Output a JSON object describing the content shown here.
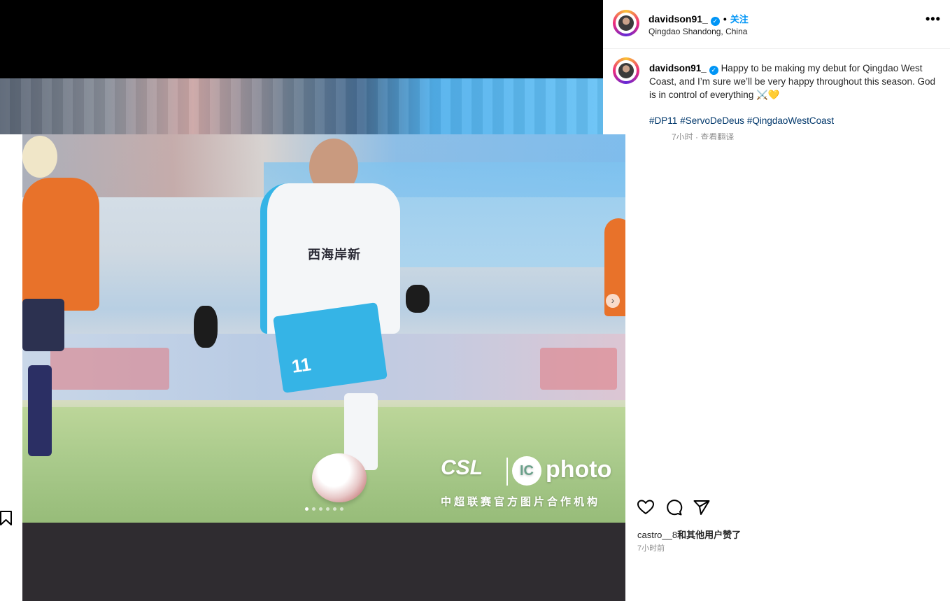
{
  "post": {
    "username": "davidson91_",
    "follow_label": "关注",
    "location": "Qingdao Shandong, China",
    "more_label": "•••"
  },
  "caption": {
    "username": "davidson91_",
    "text": "Happy to be making my debut for Qingdao West Coast, and I’m sure we’ll be very happy throughout this season. God is in control of everything ⚔️💛",
    "hashtags": [
      "#DP11",
      "#ServoDeDeus",
      "#QingdaoWestCoast"
    ],
    "meta": "7小时 · 查看翻译"
  },
  "photo": {
    "jersey_sponsor": "西海岸新",
    "shirt_number": "11",
    "watermark_logo": "CSL",
    "watermark_ic": "IC",
    "watermark_brand": "photo",
    "watermark_caption": "中超联赛官方图片合作机构",
    "carousel_count": 6,
    "carousel_active": 1
  },
  "actions": {
    "like_icon": "heart-icon",
    "comment_icon": "comment-icon",
    "share_icon": "share-icon",
    "save_icon": "bookmark-icon"
  },
  "likes": {
    "user": "castro__8",
    "suffix": "和其他用户赞了"
  },
  "time_ago": "7小时前",
  "colors": {
    "accent": "#0095f6",
    "hashtag": "#00376b",
    "jersey_orange": "#e8722a",
    "jersey_white": "#f4f6f8",
    "shorts_blue": "#35b4e6"
  }
}
